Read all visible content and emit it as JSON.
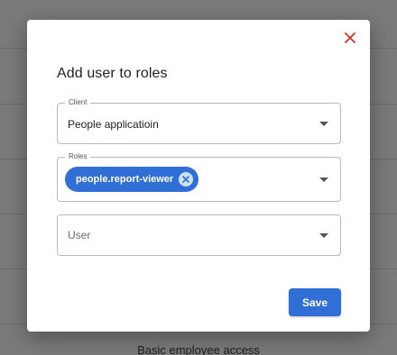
{
  "background": {
    "visible_text": "Basic employee access"
  },
  "dialog": {
    "title": "Add user to roles",
    "close_icon": "close-icon",
    "close_color": "#d93025",
    "client": {
      "legend": "Client",
      "value": "People applicatioin"
    },
    "roles": {
      "legend": "Roles",
      "chips": [
        {
          "label": "people.report-viewer"
        }
      ]
    },
    "user": {
      "placeholder": "User"
    },
    "save_label": "Save",
    "accent_color": "#2f6fd6"
  }
}
